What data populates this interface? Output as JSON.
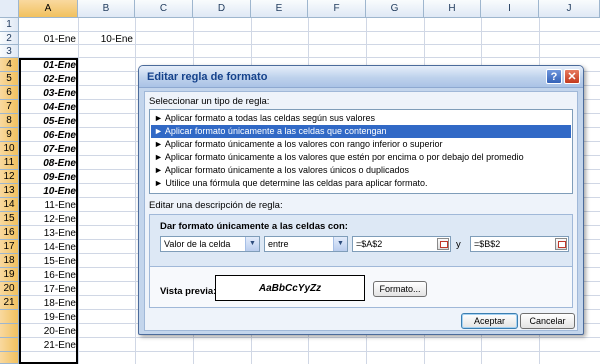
{
  "sheet": {
    "columns": [
      "A",
      "B",
      "C",
      "D",
      "E",
      "F",
      "G",
      "H",
      "I",
      "J"
    ],
    "rows": [
      "1",
      "2",
      "3",
      "4",
      "5",
      "6",
      "7",
      "8",
      "9",
      "10",
      "11",
      "12",
      "13",
      "14",
      "15",
      "16",
      "17",
      "18",
      "19",
      "20",
      "21"
    ],
    "b2": "10-Ene",
    "a_cells": [
      "",
      "01-Ene",
      "",
      "01-Ene",
      "02-Ene",
      "03-Ene",
      "04-Ene",
      "05-Ene",
      "06-Ene",
      "07-Ene",
      "08-Ene",
      "09-Ene",
      "10-Ene",
      "11-Ene",
      "12-Ene",
      "13-Ene",
      "14-Ene",
      "15-Ene",
      "16-Ene",
      "17-Ene",
      "18-Ene",
      "19-Ene",
      "20-Ene",
      "21-Ene"
    ]
  },
  "dialog": {
    "title": "Editar regla de formato",
    "help_glyph": "?",
    "close_glyph": "✕",
    "select_type_label": "Seleccionar un tipo de regla:",
    "rule_types": [
      "► Aplicar formato a todas las celdas según sus valores",
      "► Aplicar formato únicamente a las celdas que contengan",
      "► Aplicar formato únicamente a los valores con rango inferior o superior",
      "► Aplicar formato únicamente a los valores que estén por encima o por debajo del promedio",
      "► Aplicar formato únicamente a los valores únicos o duplicados",
      "► Utilice una fórmula que determine las celdas para aplicar formato."
    ],
    "selected_rule_index": 1,
    "edit_desc_label": "Editar una descripción de regla:",
    "dar_formato_label": "Dar formato únicamente a las celdas con:",
    "condition_type": "Valor de la celda",
    "operator": "entre",
    "value1": "=$A$2",
    "and_label": "y",
    "value2": "=$B$2",
    "preview_label": "Vista previa:",
    "preview_text": "AaBbCcYyZz",
    "format_button": "Formato...",
    "ok_button": "Aceptar",
    "cancel_button": "Cancelar"
  },
  "colors": {
    "selection": "#3169c6",
    "selected_header": "#f1c15f",
    "dialog_title": "#15428b"
  }
}
